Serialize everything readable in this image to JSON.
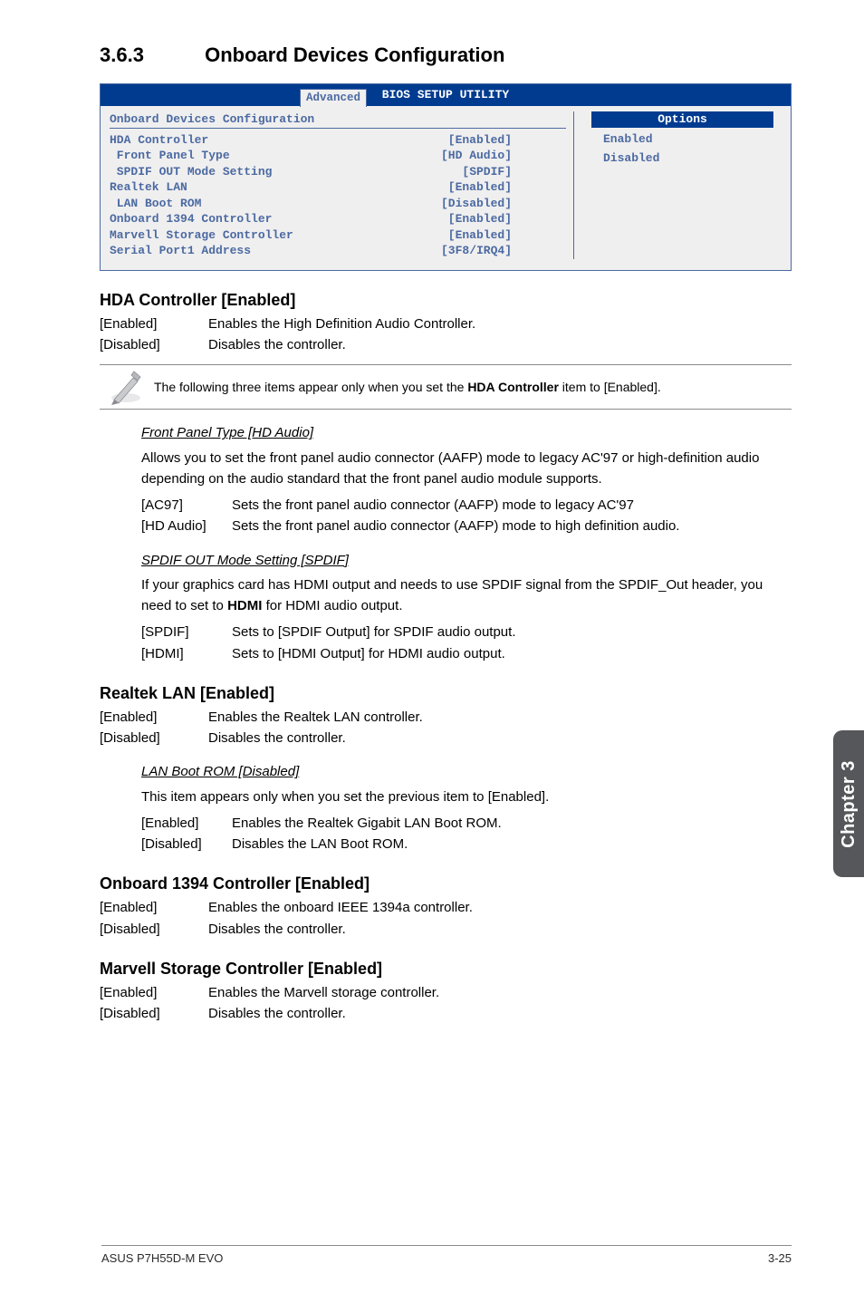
{
  "section": {
    "number": "3.6.3",
    "title": "Onboard Devices Configuration"
  },
  "bios": {
    "window_title": "BIOS SETUP UTILITY",
    "tab": "Advanced",
    "panel_title": "Onboard Devices Configuration",
    "options_box_title": "Options",
    "options": {
      "opt1": "Enabled",
      "opt2": "Disabled"
    },
    "rows": {
      "r1_label": "HDA Controller",
      "r1_value": "[Enabled]",
      "r2_label": " Front Panel Type",
      "r2_value": "[HD Audio]",
      "r3_label": " SPDIF OUT Mode Setting",
      "r3_value": "[SPDIF]",
      "r4_label": "Realtek LAN",
      "r4_value": "[Enabled]",
      "r5_label": " LAN Boot ROM",
      "r5_value": "[Disabled]",
      "r6_label": "Onboard 1394 Controller",
      "r6_value": "[Enabled]",
      "r7_label": "Marvell Storage Controller",
      "r7_value": "[Enabled]",
      "r8_label": "Serial Port1 Address",
      "r8_value": "[3F8/IRQ4]"
    }
  },
  "hda": {
    "heading": "HDA Controller [Enabled]",
    "item1_label": "[Enabled]",
    "item1_text": "Enables the High Definition Audio Controller.",
    "item2_label": "[Disabled]",
    "item2_text": "Disables the controller."
  },
  "note_text_a": "The following three items appear only when you set the ",
  "note_bold": "HDA Controller",
  "note_text_b": " item to [Enabled].",
  "fpt": {
    "heading": "Front Panel Type [HD Audio]",
    "para": "Allows you to set the front panel audio connector (AAFP) mode to legacy AC'97 or high-definition audio depending on the audio standard that the front panel audio module supports.",
    "i1_label": "[AC97]",
    "i1_text": "Sets the front panel audio connector (AAFP) mode to legacy AC'97",
    "i2_label": "[HD Audio]",
    "i2_text": "Sets the front panel audio connector (AAFP) mode to high definition audio."
  },
  "spdif": {
    "heading": "SPDIF OUT Mode Setting [SPDIF]",
    "para_a": "If your graphics card has HDMI output and needs to use SPDIF signal from the SPDIF_Out header, you need to set to ",
    "para_bold": "HDMI",
    "para_b": " for HDMI audio output.",
    "i1_label": "[SPDIF]",
    "i1_text": "Sets to [SPDIF Output] for SPDIF audio output.",
    "i2_label": "[HDMI]",
    "i2_text": "Sets to [HDMI Output] for HDMI audio output."
  },
  "realtek": {
    "heading": "Realtek LAN [Enabled]",
    "i1_label": "[Enabled]",
    "i1_text": "Enables the Realtek LAN controller.",
    "i2_label": "[Disabled]",
    "i2_text": "Disables the controller."
  },
  "lanboot": {
    "heading": "LAN Boot ROM [Disabled]",
    "para": "This item appears only when you set the previous item to [Enabled].",
    "i1_label": "[Enabled]",
    "i1_text": "Enables the Realtek Gigabit LAN Boot ROM.",
    "i2_label": "[Disabled]",
    "i2_text": "Disables the LAN Boot ROM."
  },
  "ob1394": {
    "heading": "Onboard 1394 Controller [Enabled]",
    "i1_label": "[Enabled]",
    "i1_text": "Enables the onboard IEEE 1394a controller.",
    "i2_label": "[Disabled]",
    "i2_text": "Disables the controller."
  },
  "marvell": {
    "heading": "Marvell Storage Controller [Enabled]",
    "i1_label": "[Enabled]",
    "i1_text": "Enables the Marvell storage controller.",
    "i2_label": "[Disabled]",
    "i2_text": "Disables the controller."
  },
  "sidetab": "Chapter 3",
  "footer": {
    "left": "ASUS P7H55D-M EVO",
    "right": "3-25"
  }
}
